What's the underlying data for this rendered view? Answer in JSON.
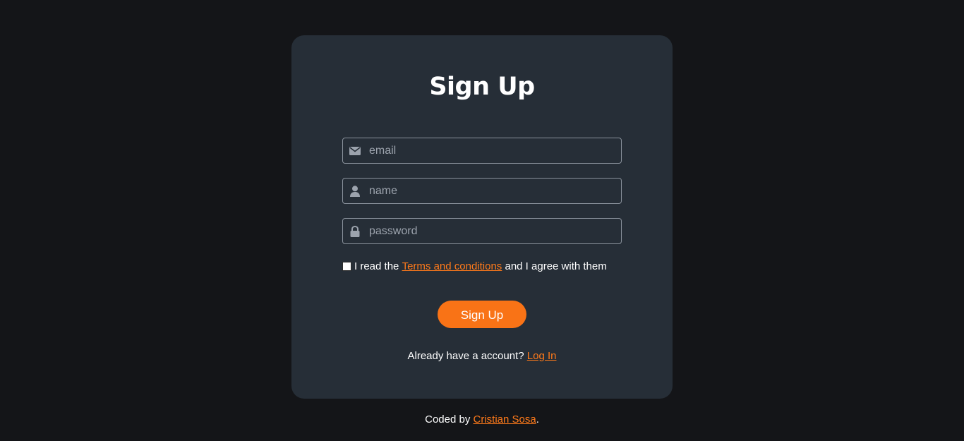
{
  "signup": {
    "title": "Sign Up",
    "fields": {
      "email": {
        "placeholder": "email",
        "icon": "envelope-icon"
      },
      "name": {
        "placeholder": "name",
        "icon": "user-icon"
      },
      "password": {
        "placeholder": "password",
        "icon": "lock-icon"
      }
    },
    "terms": {
      "prefix": "I read the",
      "link": "Terms and conditions",
      "suffix": "and I agree with them",
      "checked": false
    },
    "submit_label": "Sign Up",
    "login_prompt": "Already have a account?",
    "login_link": "Log In"
  },
  "footer": {
    "prefix": "Coded by",
    "author": "Cristian Sosa",
    "suffix": "."
  },
  "colors": {
    "background": "#141518",
    "card": "#262e37",
    "accent": "#f97316",
    "text": "#ffffff",
    "placeholder": "#9ca3ad"
  }
}
